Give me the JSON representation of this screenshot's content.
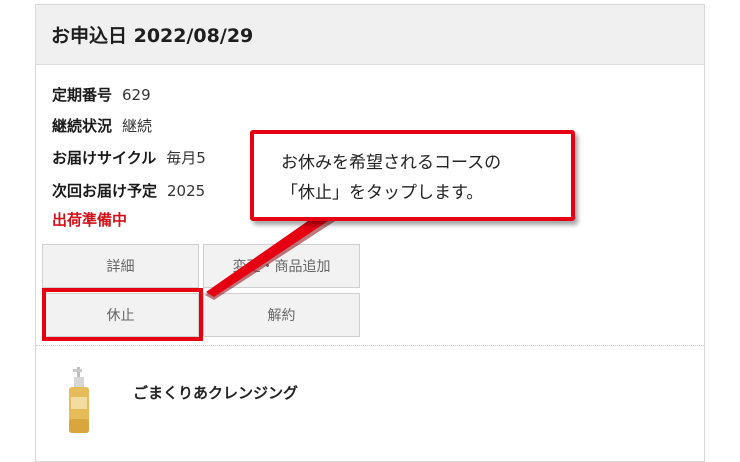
{
  "header": {
    "title": "お申込日 2022/08/29"
  },
  "info": {
    "number_label": "定期番号",
    "number_value": "629",
    "status_label": "継続状況",
    "status_value": "継続",
    "cycle_label": "お届けサイクル",
    "cycle_value": "毎月5",
    "next_label": "次回お届け予定",
    "next_value": "2025",
    "shipping_status": "出荷準備中"
  },
  "buttons": {
    "detail": "詳細",
    "change": "変更・商品追加",
    "pause": "休止",
    "cancel": "解約"
  },
  "product": {
    "name": "ごまくりあクレンジング"
  },
  "callout": {
    "line1": "お休みを希望されるコースの",
    "line2": "「休止」をタップします。"
  },
  "colors": {
    "accent_red": "#e50012",
    "status_red": "#d0121b",
    "header_bg": "#f0f0f0"
  }
}
